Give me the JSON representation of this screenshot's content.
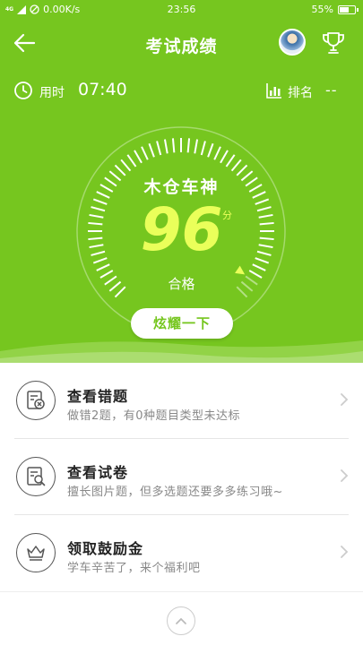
{
  "statusbar": {
    "network": "4G",
    "speed": "0.00K/s",
    "time": "23:56",
    "battery": "55%"
  },
  "header": {
    "title": "考试成绩",
    "back_icon": "arrow-left-icon",
    "trophy_icon": "trophy-icon"
  },
  "stats": {
    "time_label": "用时",
    "time_value": "07:40",
    "rank_label": "排名",
    "rank_value": "--"
  },
  "result": {
    "nickname": "木仓车神",
    "score": "96",
    "score_unit": "分",
    "status": "合格",
    "show_off_button": "炫耀一下",
    "gauge_level": 0.96
  },
  "items": [
    {
      "title": "查看错题",
      "desc": "做错2题，有0种题目类型未达标",
      "icon": "wrong-questions-icon"
    },
    {
      "title": "查看试卷",
      "desc": "擅长图片题，但多选题还要多多练习哦~",
      "icon": "paper-search-icon"
    },
    {
      "title": "领取鼓励金",
      "desc": "学车辛苦了，来个福利吧",
      "icon": "crown-icon"
    }
  ],
  "colors": {
    "primary": "#76c61f",
    "accent": "#eaff5a"
  }
}
